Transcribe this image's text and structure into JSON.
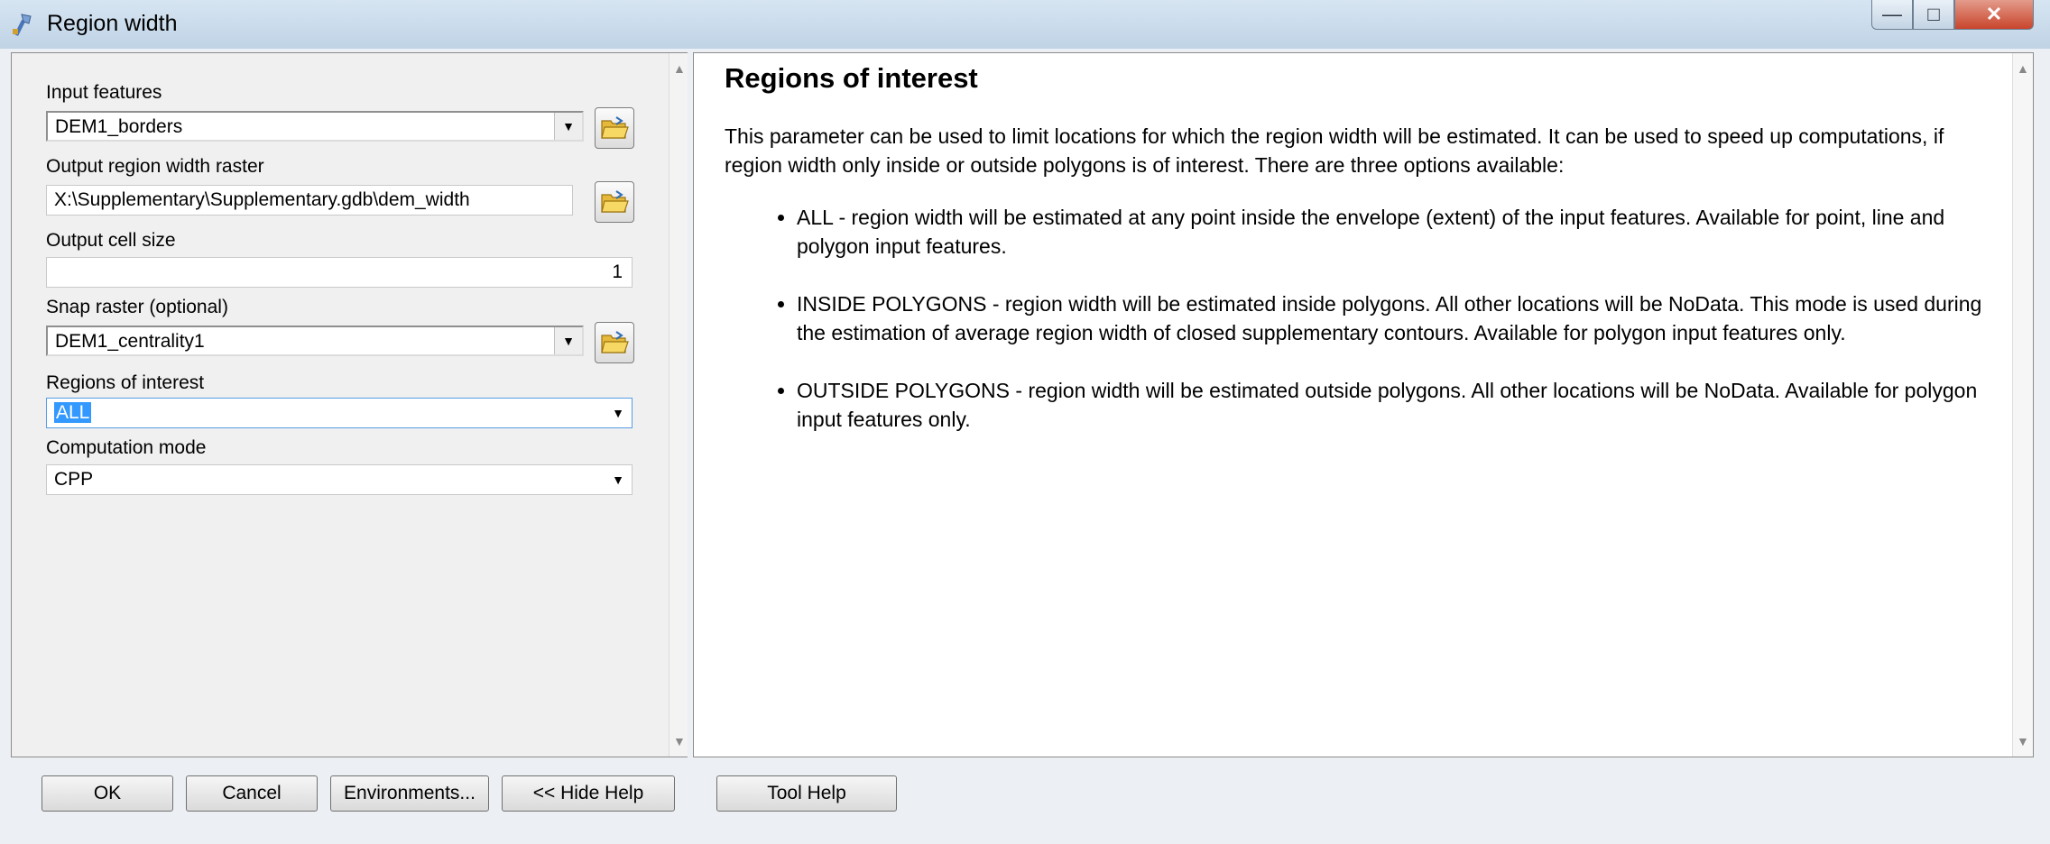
{
  "window": {
    "title": "Region width",
    "minimize_glyph": "—",
    "maximize_glyph": "□",
    "close_glyph": "✕"
  },
  "form": {
    "input_features": {
      "label": "Input features",
      "value": "DEM1_borders"
    },
    "output_raster": {
      "label": "Output region width raster",
      "value": "X:\\Supplementary\\Supplementary.gdb\\dem_width"
    },
    "cell_size": {
      "label": "Output cell size",
      "value": "1"
    },
    "snap_raster": {
      "label": "Snap raster (optional)",
      "value": "DEM1_centrality1"
    },
    "regions": {
      "label": "Regions of interest",
      "value": "ALL"
    },
    "computation": {
      "label": "Computation mode",
      "value": "CPP"
    }
  },
  "help": {
    "title": "Regions of interest",
    "intro": "This parameter can be used to limit locations for which the region width will be estimated. It can be used to speed up computations, if region width only inside or outside polygons is of interest. There are three options available:",
    "items": [
      "ALL - region width will be estimated at any point inside the envelope (extent) of the input features. Available for point, line and polygon input features.",
      "INSIDE POLYGONS - region width will be estimated inside polygons. All other locations will be NoData. This mode is used during the estimation of average region width of closed supplementary contours. Available for polygon input features only.",
      "OUTSIDE POLYGONS - region width will be estimated outside polygons. All other locations will be NoData. Available for polygon input features only."
    ]
  },
  "buttons": {
    "ok": "OK",
    "cancel": "Cancel",
    "environments": "Environments...",
    "hide_help": "<< Hide Help",
    "tool_help": "Tool Help"
  },
  "icons": [
    "tool-icon",
    "folder-open-icon",
    "chevron-down-icon",
    "scroll-up-icon",
    "scroll-down-icon"
  ],
  "colors": {
    "selection": "#3399ff",
    "titlebar": "#c7d9ea",
    "close_button": "#c9452c"
  }
}
